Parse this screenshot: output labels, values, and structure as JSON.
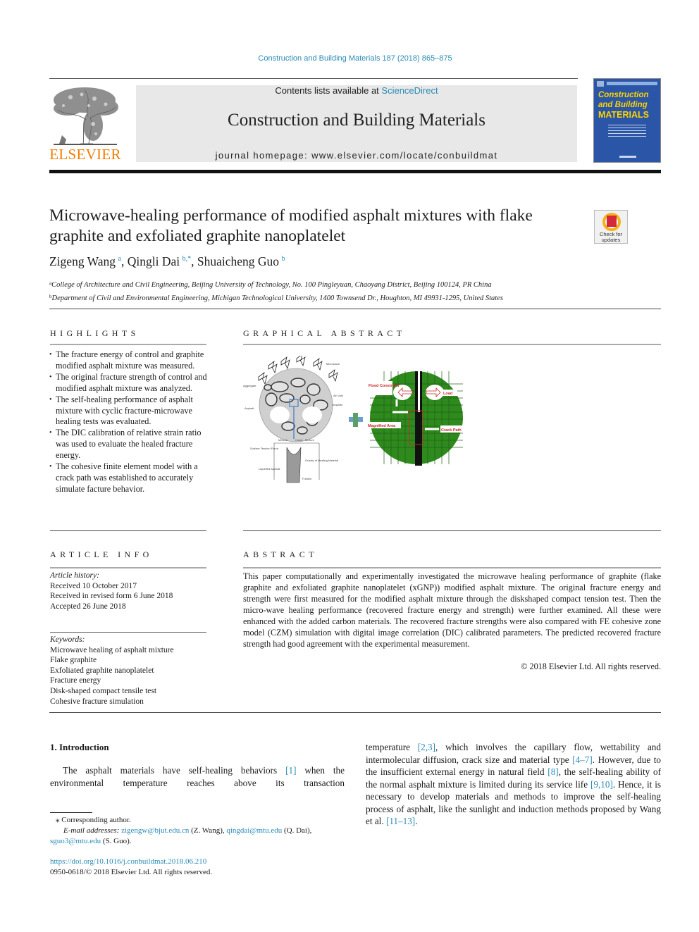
{
  "header": {
    "citation": "Construction and Building Materials 187 (2018) 865–875",
    "publisher_logo_text": "ELSEVIER",
    "contents_prefix": "Contents lists available at ",
    "contents_link": "ScienceDirect",
    "journal_name": "Construction and Building Materials",
    "homepage": "journal homepage: www.elsevier.com/locate/conbuildmat",
    "cover": {
      "line1": "Construction",
      "line2": "and Building",
      "line3": "MATERIALS"
    },
    "colors": {
      "link": "#2a8bb5",
      "elsevier_orange": "#f07d00",
      "cover_blue": "#2b55a6",
      "cover_yellow": "#ffd400"
    }
  },
  "article": {
    "title": "Microwave-healing performance of modified asphalt mixtures with flake graphite and exfoliated graphite nanoplatelet",
    "crossmark_label": "Check for updates",
    "authors": [
      {
        "name": "Zigeng Wang",
        "sup": "a"
      },
      {
        "name": "Qingli Dai",
        "sup": "b,*"
      },
      {
        "name": "Shuaicheng Guo",
        "sup": "b"
      }
    ],
    "affiliations": [
      {
        "sup": "a",
        "text": "College of Architecture and Civil Engineering, Beijing University of Technology, No. 100 Pingleyuan, Chaoyang District, Beijing 100124, PR China"
      },
      {
        "sup": "b",
        "text": "Department of Civil and Environmental Engineering, Michigan Technological University, 1400 Townsend Dr., Houghton, MI 49931-1295, United States"
      }
    ]
  },
  "highlights": {
    "heading": "HIGHLIGHTS",
    "items": [
      "The fracture energy of control and graphite modified asphalt mixture was measured.",
      "The original fracture strength of control and modified asphalt mixture was analyzed.",
      "The self-healing performance of asphalt mixture with cyclic fracture-microwave healing tests was evaluated.",
      "The DIC calibration of relative strain ratio was used to evaluate the healed fracture energy.",
      "The cohesive finite element model with a crack path was established to accurately simulate facture behavior."
    ]
  },
  "graphical_abstract": {
    "heading": "GRAPHICAL ABSTRACT",
    "left_labels": {
      "microwave": "Microwave",
      "aggregate": "Aggregate",
      "air_void": "Air Void",
      "asphalt": "Asphalt",
      "graphite": "Graphite",
      "mixture_left": "Mixture",
      "crack": "Crack",
      "mixture_right": "Mixture",
      "surface_tension": "Surface Tension Force",
      "liquefied_asphalt": "Liquefied Asphalt",
      "gravity": "Gravity of Healing Material",
      "friction": "Friction"
    },
    "right_labels": {
      "fixed": "Fixed Constraint",
      "load": "Load",
      "magnified": "Magnified Area",
      "crack_path": "Crack Path"
    }
  },
  "article_info": {
    "heading": "ARTICLE INFO",
    "history_label": "Article history:",
    "history": [
      "Received 10 October 2017",
      "Received in revised form 6 June 2018",
      "Accepted 26 June 2018"
    ],
    "keywords_label": "Keywords:",
    "keywords": [
      "Microwave healing of asphalt mixture",
      "Flake graphite",
      "Exfoliated graphite nanoplatelet",
      "Fracture energy",
      "Disk-shaped compact tensile test",
      "Cohesive fracture simulation"
    ]
  },
  "abstract": {
    "heading": "ABSTRACT",
    "text": "This paper computationally and experimentally investigated the microwave healing performance of gra­phite (flake graphite and exfoliated graphite nanoplatelet (xGNP)) modified asphalt mixture. The original fracture energy and strength were first measured for the modified asphalt mixture through the disk­shaped compact tension test. Then the micro-wave healing performance (recovered fracture energy and strength) were further examined. All these were enhanced with the added carbon materials. The recovered fracture strengths were also compared with FE cohesive zone model (CZM) simulation with digital image correlation (DIC) calibrated parameters. The predicted recovered fracture strength had good agreement with the experimental measurement.",
    "copyright": "© 2018 Elsevier Ltd. All rights reserved."
  },
  "body": {
    "section_heading": "1. Introduction",
    "left_para": [
      {
        "t": "The asphalt materials have self-healing behaviors "
      },
      {
        "ref": "[1]"
      },
      {
        "t": " when the environmental temperature reaches above its transaction"
      }
    ],
    "right_para": [
      {
        "t": "temperature "
      },
      {
        "ref": "[2,3]"
      },
      {
        "t": ", which involves the capillary flow, wettability and intermolecular diffusion, crack size and material type "
      },
      {
        "ref": "[4–7]"
      },
      {
        "t": ". However, due to the insufficient external energy in natural field "
      },
      {
        "ref": "[8]"
      },
      {
        "t": ", the self-healing ability of the normal asphalt mixture is limited during its service life "
      },
      {
        "ref": "[9,10]"
      },
      {
        "t": ". Hence, it is necessary to develop materials and methods to improve the self-healing process of asphalt, like the sunlight and induction methods proposed by Wang et al. "
      },
      {
        "ref": "[11–13]"
      },
      {
        "t": "."
      }
    ]
  },
  "footnotes": {
    "corresponding": "⁎ Corresponding author.",
    "email_label": "E-mail addresses:",
    "emails": [
      {
        "addr": "zigengw@bjut.edu.cn",
        "who": " (Z. Wang), "
      },
      {
        "addr": "qingdai@mtu.edu",
        "who": " (Q. Dai), "
      },
      {
        "addr": "sguo3@mtu.edu",
        "who": " (S. Guo)."
      }
    ],
    "doi": "https://doi.org/10.1016/j.conbuildmat.2018.06.210",
    "issn_copyright": "0950-0618/© 2018 Elsevier Ltd. All rights reserved."
  }
}
